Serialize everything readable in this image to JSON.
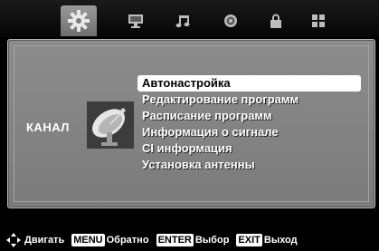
{
  "tabs": [
    {
      "name": "settings-tab",
      "icon": "gear-icon"
    },
    {
      "name": "picture-tab",
      "icon": "monitor-icon"
    },
    {
      "name": "sound-tab",
      "icon": "music-note-icon"
    },
    {
      "name": "time-tab",
      "icon": "clock-icon"
    },
    {
      "name": "lock-tab",
      "icon": "lock-icon"
    },
    {
      "name": "app-tab",
      "icon": "grid-icon"
    }
  ],
  "section": {
    "label": "КАНАЛ",
    "icon": "satellite-dish-icon"
  },
  "menu": {
    "items": [
      "Автонастройка",
      "Редактирование программ",
      "Расписание программ",
      "Информация о сигнале",
      "CI информация",
      "Установка антенны"
    ],
    "selected_index": 0
  },
  "footer": {
    "move_label": "Двигать",
    "menu_key": "MENU",
    "menu_label": "Обратно",
    "enter_key": "ENTER",
    "enter_label": "Выбор",
    "exit_key": "EXIT",
    "exit_label": "Выход"
  }
}
